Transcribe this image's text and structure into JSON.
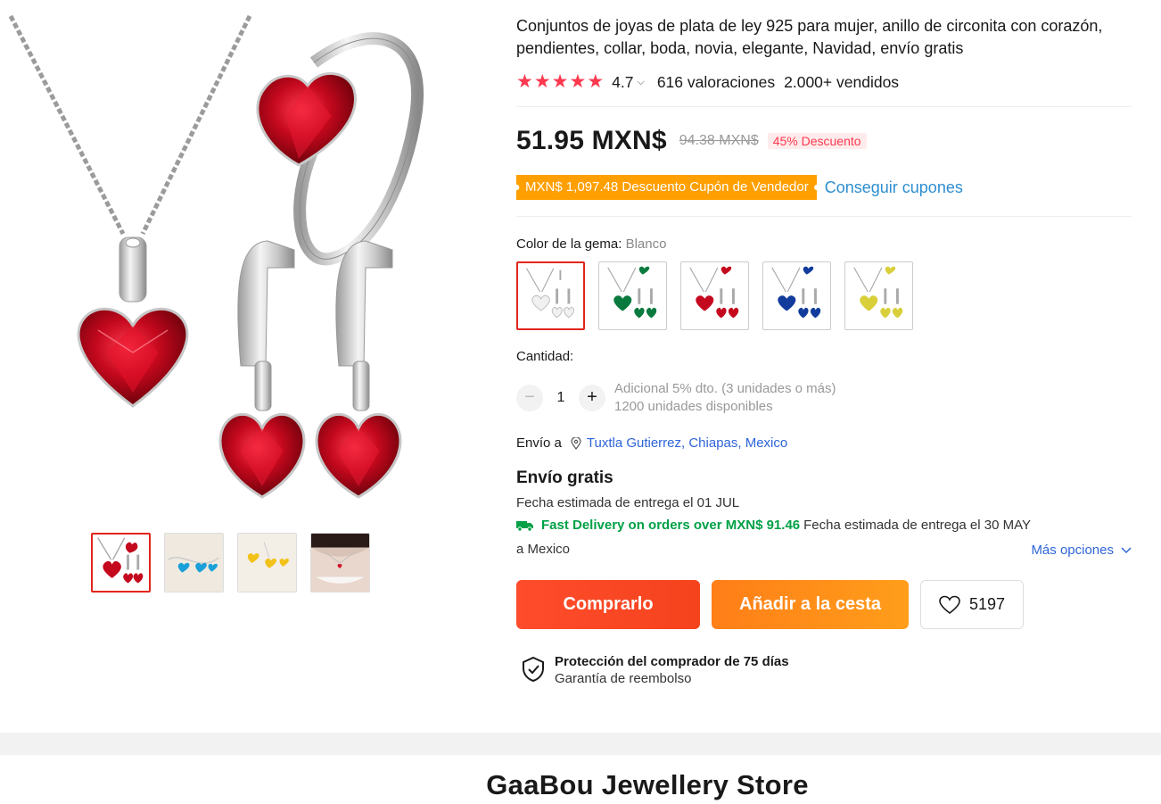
{
  "product": {
    "title": "Conjuntos de joyas de plata de ley 925 para mujer, anillo de circonita con corazón, pendientes, collar, boda, novia, elegante, Navidad, envío gratis",
    "rating": "4.7",
    "reviews": "616 valoraciones",
    "sold": "2.000+ vendidos",
    "star_color": "#fd384f"
  },
  "price": {
    "current": "51.95 MXN$",
    "original": "94.38 MXN$",
    "discount": "45% Descuento"
  },
  "coupon": {
    "tag": "MXN$ 1,097.48 Descuento Cupón de Vendedor",
    "link": "Conseguir cupones"
  },
  "variant": {
    "label": "Color de la gema:",
    "selected": "Blanco",
    "options": [
      "white-gem-set",
      "green-gem-set",
      "red-gem-set",
      "blue-gem-set",
      "yellow-gem-set"
    ]
  },
  "quantity": {
    "label": "Cantidad:",
    "minus": "−",
    "plus": "+",
    "value": "1",
    "note1": "Adicional 5% dto. (3 unidades o más)",
    "note2": "1200 unidades disponibles"
  },
  "shipping": {
    "to_label": "Envío a",
    "location": "Tuxtla Gutierrez, Chiapas, Mexico",
    "free": "Envío gratis",
    "eta": "Fecha estimada de entrega el 01 JUL",
    "fast": "Fast Delivery on orders over MXN$ 91.46",
    "fast_eta": "Fecha estimada de entrega el 30 MAY",
    "country": "a Mexico",
    "more": "Más opciones"
  },
  "actions": {
    "buy": "Comprarlo",
    "cart": "Añadir a la cesta",
    "wishlist_count": "5197"
  },
  "protection": {
    "title": "Protección del comprador de 75 días",
    "subtitle": "Garantía de reembolso"
  },
  "store": {
    "name": "GaaBou Jewellery Store"
  }
}
